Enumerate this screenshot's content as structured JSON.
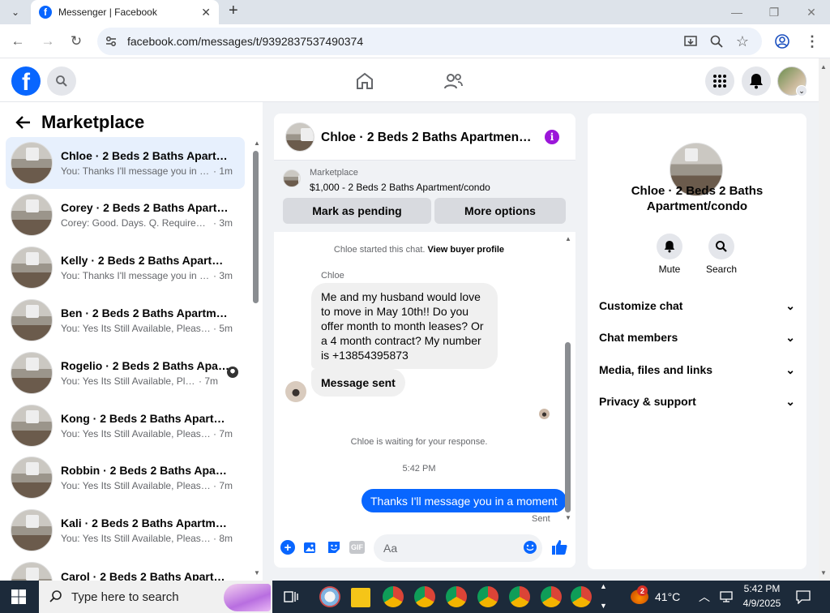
{
  "browser": {
    "tab_title": "Messenger | Facebook",
    "url": "facebook.com/messages/t/9392837537490374"
  },
  "left": {
    "title": "Marketplace",
    "conversations": [
      {
        "name": "Chloe · 2 Beds 2 Baths Apartme...",
        "preview": "You: Thanks I'll message you in a ...",
        "time": "· 1m",
        "active": true
      },
      {
        "name": "Corey · 2 Beds 2 Baths Apartme...",
        "preview": "Corey: Good. Days. Q. Requiremen...",
        "time": "· 3m"
      },
      {
        "name": "Kelly · 2 Beds 2 Baths Apartmen...",
        "preview": "You: Thanks I'll message you in a ...",
        "time": "· 3m"
      },
      {
        "name": "Ben · 2 Beds 2 Baths Apartment...",
        "preview": "You: Yes Its Still Available, Please S...",
        "time": "· 5m"
      },
      {
        "name": "Rogelio · 2 Beds 2 Baths Apar...",
        "preview": "You: Yes Its Still Available, Pleas...",
        "time": "· 7m"
      },
      {
        "name": "Kong · 2 Beds 2 Baths Apartmen...",
        "preview": "You: Yes Its Still Available, Please S...",
        "time": "· 7m"
      },
      {
        "name": "Robbin · 2 Beds 2 Baths Apartm...",
        "preview": "You: Yes Its Still Available, Please S...",
        "time": "· 7m"
      },
      {
        "name": "Kali · 2 Beds 2 Baths Apartment...",
        "preview": "You: Yes Its Still Available, Please S...",
        "time": "· 8m"
      },
      {
        "name": "Carol · 2 Beds 2 Baths Apartm...",
        "preview": "",
        "time": ""
      }
    ]
  },
  "chat": {
    "header_title": "Chloe · 2 Beds 2 Baths Apartment/c...",
    "listing_source": "Marketplace",
    "listing_title": "$1,000 - 2 Beds 2 Baths Apartment/condo",
    "mark_pending": "Mark as pending",
    "more_options": "More options",
    "started_text": "Chloe started this chat.",
    "buyer_profile_link": "View buyer profile",
    "sender": "Chloe",
    "message1": "Me and my husband would love to move in May 10th!! Do you offer month to month leases? Or a 4 month contract? My number is +13854395873",
    "message2": "Message sent",
    "waiting": "Chloe is waiting for your response.",
    "timestamp": "5:42 PM",
    "my_message": "Thanks I'll message you in a moment",
    "sent_label": "Sent",
    "composer_placeholder": "Aa",
    "gif_label": "GIF"
  },
  "right": {
    "name": "Chloe · 2 Beds 2 Baths Apartment/condo",
    "mute": "Mute",
    "search": "Search",
    "sections": [
      "Customize chat",
      "Chat members",
      "Media, files and links",
      "Privacy & support"
    ]
  },
  "taskbar": {
    "search_placeholder": "Type here to search",
    "weather": "41°C",
    "weather_badge": "2",
    "time": "5:42 PM",
    "date": "4/9/2025"
  },
  "colors": {
    "accent": "#0866ff",
    "chat_bubble": "#f0f0f0",
    "sidebar_active": "#e7f0fd"
  }
}
